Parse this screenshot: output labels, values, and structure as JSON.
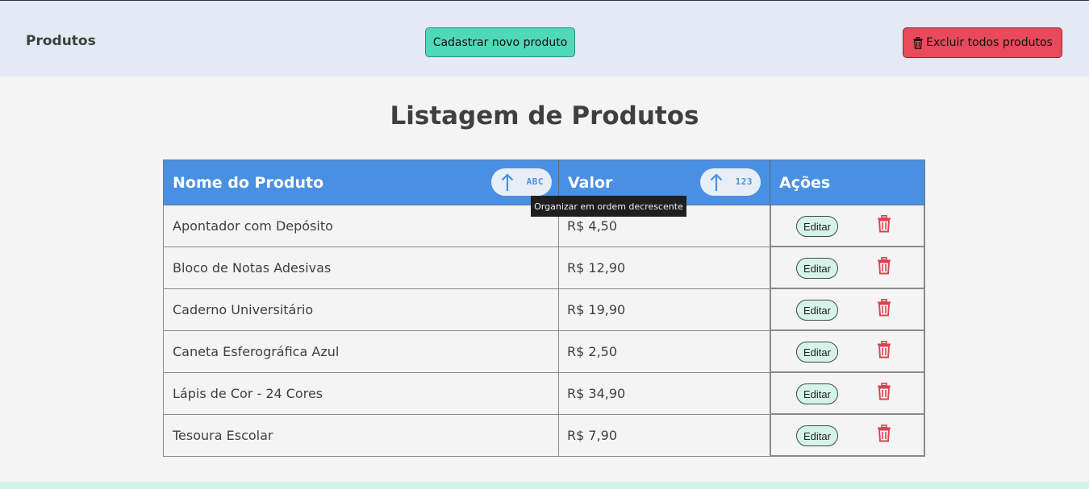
{
  "header": {
    "brand": "Produtos",
    "new_button": "Cadastrar novo produto",
    "delete_all_button": "Excluir todos produtos"
  },
  "main": {
    "title": "Listagem de Produtos",
    "table": {
      "columns": [
        "Nome do Produto",
        "Valor",
        "Ações"
      ],
      "sort_name_code": "ABC",
      "sort_value_code": "123",
      "tooltip": "Organizar em ordem decrescente",
      "edit_label": "Editar",
      "rows": [
        {
          "name": "Apontador com Depósito",
          "value": "R$ 4,50"
        },
        {
          "name": "Bloco de Notas Adesivas",
          "value": "R$ 12,90"
        },
        {
          "name": "Caderno Universitário",
          "value": "R$ 19,90"
        },
        {
          "name": "Caneta Esferográfica Azul",
          "value": "R$ 2,50"
        },
        {
          "name": "Lápis de Cor - 24 Cores",
          "value": "R$ 34,90"
        },
        {
          "name": "Tesoura Escolar",
          "value": "R$ 7,90"
        }
      ]
    }
  },
  "colors": {
    "header_bg": "#e3eaf3",
    "accent_blue": "#4a90e2",
    "new_button": "#4fd9b6",
    "danger": "#e8495b",
    "edit_button": "#d6f3ea",
    "trash_icon": "#d9434f"
  },
  "icons": {
    "trash": "trash-icon",
    "sort_arrow": "arrow-up-icon"
  }
}
